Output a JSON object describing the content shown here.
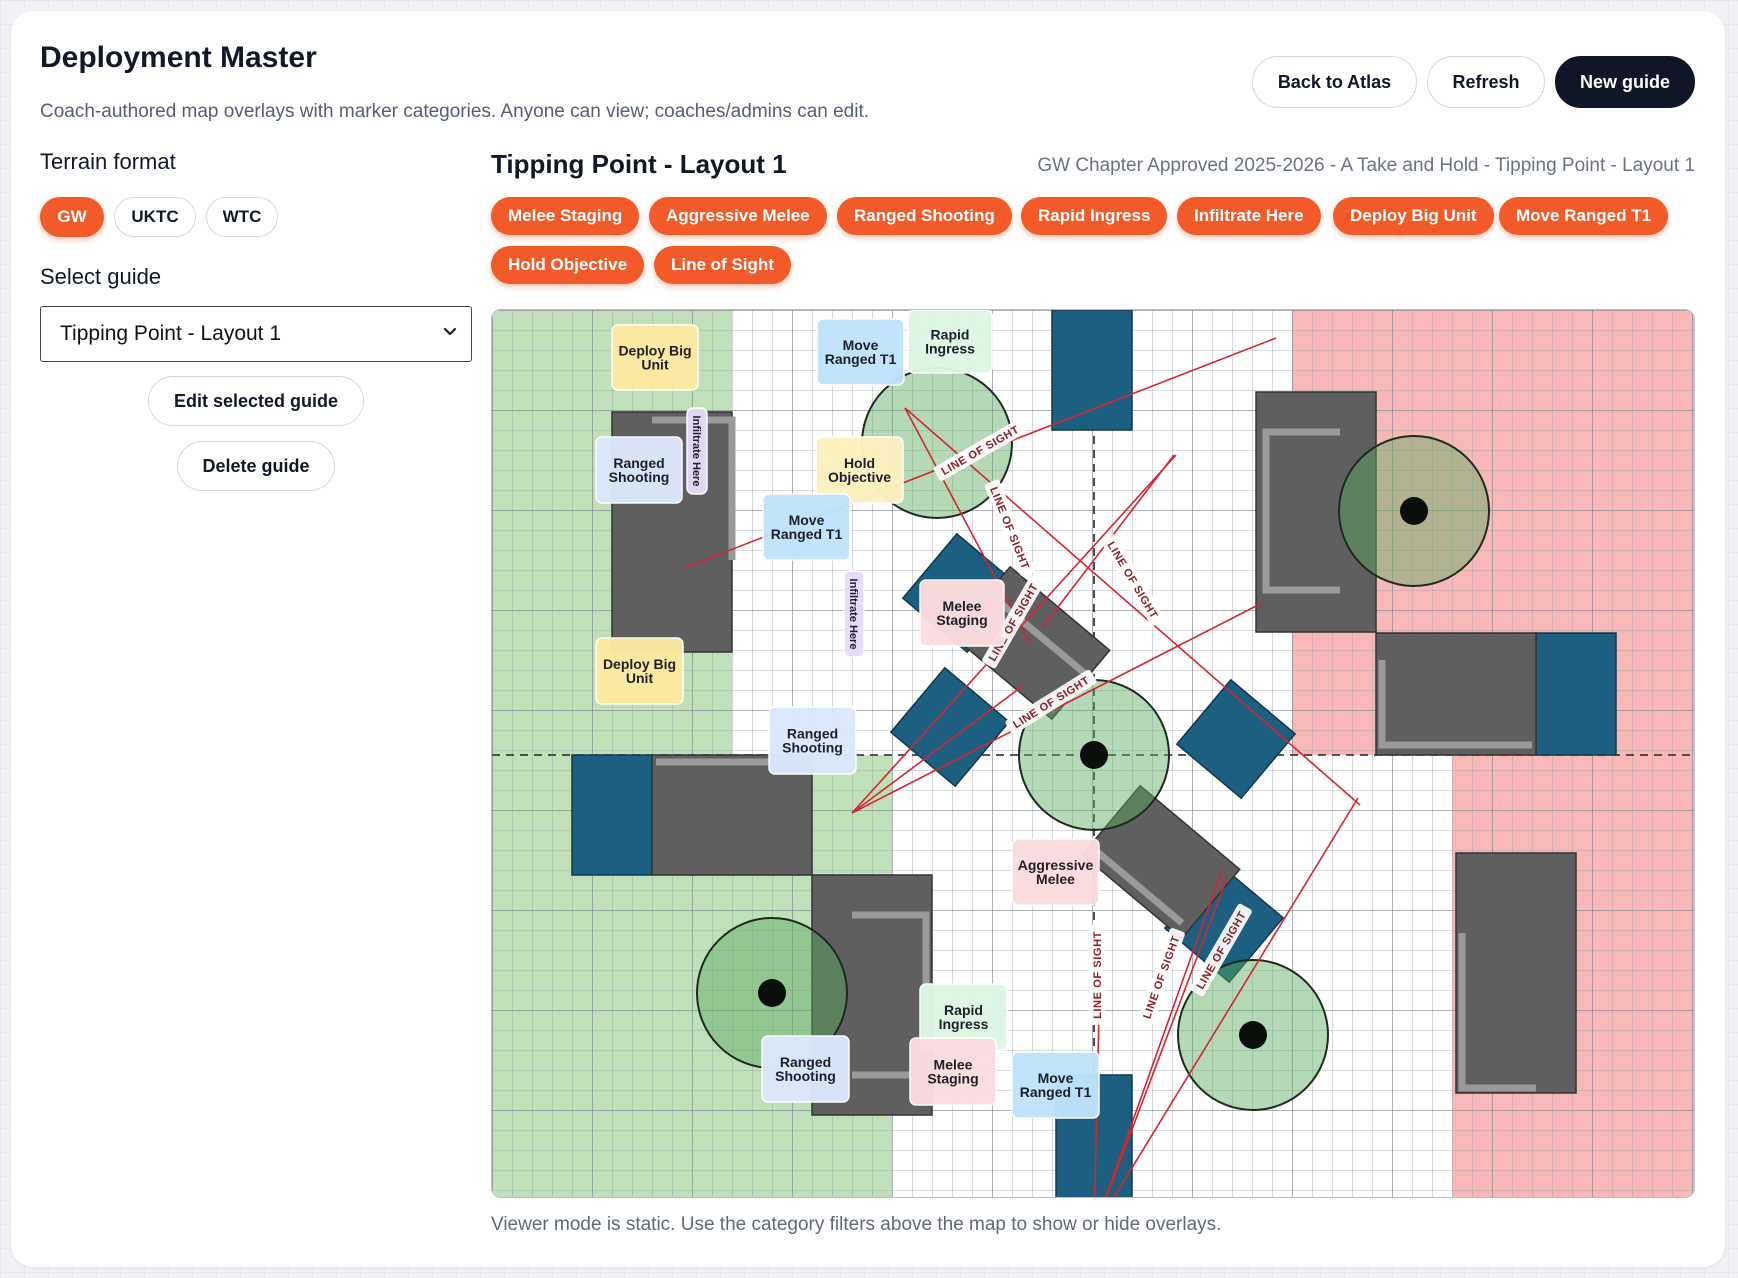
{
  "header": {
    "title": "Deployment Master",
    "subtitle": "Coach-authored map overlays with marker categories. Anyone can view; coaches/admins can edit.",
    "back_label": "Back to Atlas",
    "refresh_label": "Refresh",
    "new_label": "New guide"
  },
  "sidebar": {
    "terrain_label": "Terrain format",
    "formats": [
      "GW",
      "UKTC",
      "WTC"
    ],
    "selected_format": "GW",
    "select_label": "Select guide",
    "selected_guide": "Tipping Point - Layout 1",
    "edit_label": "Edit selected guide",
    "delete_label": "Delete guide"
  },
  "guide": {
    "title": "Tipping Point - Layout 1",
    "full_name": "GW Chapter Approved 2025-2026 - A Take and Hold - Tipping Point - Layout 1",
    "categories": [
      "Melee Staging",
      "Aggressive Melee",
      "Ranged Shooting",
      "Rapid Ingress",
      "Infiltrate Here",
      "Deploy Big Unit",
      "Move Ranged T1",
      "Hold Objective",
      "Line of Sight"
    ],
    "footnote": "Viewer mode is static. Use the category filters above the map to show or hide overlays."
  },
  "map": {
    "markers": [
      {
        "label": "Deploy Big Unit",
        "category": "deploy",
        "lines": [
          "Deploy Big",
          "Unit"
        ]
      },
      {
        "label": "Move Ranged T1",
        "category": "move",
        "lines": [
          "Move",
          "Ranged T1"
        ]
      },
      {
        "label": "Rapid Ingress",
        "category": "rapid",
        "lines": [
          "Rapid",
          "Ingress"
        ]
      },
      {
        "label": "Ranged Shooting",
        "category": "ranged",
        "lines": [
          "Ranged",
          "Shooting"
        ]
      },
      {
        "label": "Infiltrate Here",
        "category": "infiltrate",
        "lines": [
          "Infiltrate Here"
        ]
      },
      {
        "label": "Hold Objective",
        "category": "hold",
        "lines": [
          "Hold",
          "Objective"
        ]
      },
      {
        "label": "Move Ranged T1",
        "category": "move",
        "lines": [
          "Move",
          "Ranged T1"
        ]
      },
      {
        "label": "Infiltrate Here",
        "category": "infiltrate",
        "lines": [
          "Infiltrate Here"
        ]
      },
      {
        "label": "Melee Staging",
        "category": "melee",
        "lines": [
          "Melee",
          "Staging"
        ]
      },
      {
        "label": "Deploy Big Unit",
        "category": "deploy",
        "lines": [
          "Deploy Big",
          "Unit"
        ]
      },
      {
        "label": "Ranged Shooting",
        "category": "ranged",
        "lines": [
          "Ranged",
          "Shooting"
        ]
      },
      {
        "label": "Aggressive Melee",
        "category": "aggressive",
        "lines": [
          "Aggressive",
          "Melee"
        ]
      },
      {
        "label": "Rapid Ingress",
        "category": "rapid",
        "lines": [
          "Rapid",
          "Ingress"
        ]
      },
      {
        "label": "Ranged Shooting",
        "category": "ranged",
        "lines": [
          "Ranged",
          "Shooting"
        ]
      },
      {
        "label": "Melee Staging",
        "category": "melee",
        "lines": [
          "Melee",
          "Staging"
        ]
      },
      {
        "label": "Move Ranged T1",
        "category": "move",
        "lines": [
          "Move",
          "Ranged T1"
        ]
      }
    ],
    "los_label": "LINE OF SIGHT",
    "category_colors": {
      "deploy": "#fdeaa0",
      "move": "#bfe3fb",
      "rapid": "#dcf7e3",
      "ranged": "#dbe8fc",
      "infiltrate": "#e7d9fb",
      "hold": "#fdf1c0",
      "melee": "#fcdde0",
      "aggressive": "#fcdcdc"
    },
    "zone_colors": {
      "player1": "#bfe0b8",
      "player2": "#f9b8b8",
      "ruin": "#5f5f5f",
      "wall": "#1d5f80",
      "los": "#d3262e"
    }
  }
}
